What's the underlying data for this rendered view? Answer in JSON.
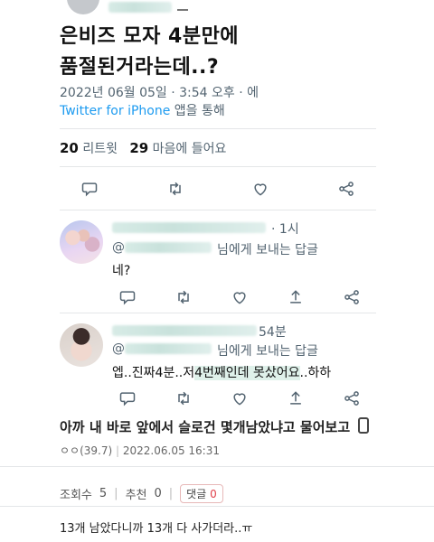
{
  "tweet": {
    "text_line1": "은비즈 모자 4분만에",
    "text_line2": "품절된거라는데..?",
    "meta": "2022년 06월 05일 · 3:54 오후 · 에",
    "source": "Twitter for iPhone",
    "source_suffix": " 앱을 통해",
    "retweets_count": "20",
    "retweets_label": "리트윗",
    "likes_count": "29",
    "likes_label": "마음에 들어요"
  },
  "replies": [
    {
      "time": "1시",
      "reply_prefix": "@",
      "reply_suffix": "님에게 보내는 답글",
      "body": "네?"
    },
    {
      "time": "54분",
      "reply_prefix": "@",
      "reply_suffix": "님에게 보내는 답글",
      "body_part1": "엡..진짜4분..저",
      "body_highlight": "4번째인데 못샀어요",
      "body_part2": "..하하"
    }
  ],
  "post": {
    "title": "아까 내 바로 앞에서 슬로건 몇개남았냐고 물어보고",
    "author": "ㅇㅇ(39.7)",
    "datetime": "2022.06.05 16:31",
    "views_label": "조회수",
    "views": "5",
    "recommend_label": "추천",
    "recommend": "0",
    "comments_label": "댓글",
    "comments": "0",
    "comment_text": "13개 남았다니까 13개 다 사가더라..ㅠ"
  },
  "icons": [
    "reply-icon",
    "retweet-icon",
    "like-icon",
    "share-icon",
    "phone-icon"
  ],
  "colors": {
    "link": "#1d9bf0",
    "muted": "#536471",
    "badge_count": "#e0404a"
  }
}
